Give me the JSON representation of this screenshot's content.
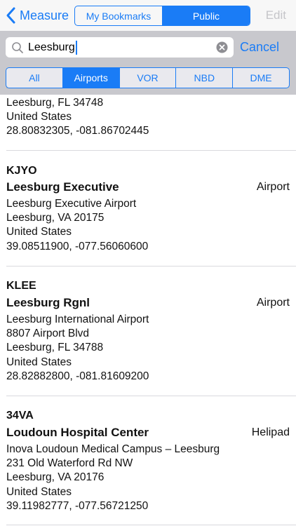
{
  "nav": {
    "back_label": "Measure",
    "segments": [
      "My Bookmarks",
      "Public"
    ],
    "selected_segment": "Public",
    "edit_label": "Edit"
  },
  "search": {
    "value": "Leesburg",
    "cancel_label": "Cancel",
    "filters": [
      "All",
      "Airports",
      "VOR",
      "NBD",
      "DME"
    ],
    "selected_filter": "Airports"
  },
  "results": [
    {
      "lines": [
        "Leesburg, FL  34748",
        "United States",
        "28.80832305, -081.86702445"
      ]
    },
    {
      "code": "KJYO",
      "name": "Leesburg Executive",
      "kind": "Airport",
      "lines": [
        "Leesburg Executive Airport",
        "Leesburg, VA  20175",
        "United States",
        "39.08511900, -077.56060600"
      ]
    },
    {
      "code": "KLEE",
      "name": "Leesburg Rgnl",
      "kind": "Airport",
      "lines": [
        "Leesburg International Airport",
        "8807 Airport Blvd",
        "Leesburg, FL  34788",
        "United States",
        "28.82882800, -081.81609200"
      ]
    },
    {
      "code": "34VA",
      "name": "Loudoun Hospital Center",
      "kind": "Helipad",
      "lines": [
        "Inova Loudoun Medical Campus – Leesburg",
        "231 Old Waterford Rd NW",
        "Leesburg, VA  20176",
        "United States",
        "39.11982777, -077.56721250"
      ]
    }
  ]
}
